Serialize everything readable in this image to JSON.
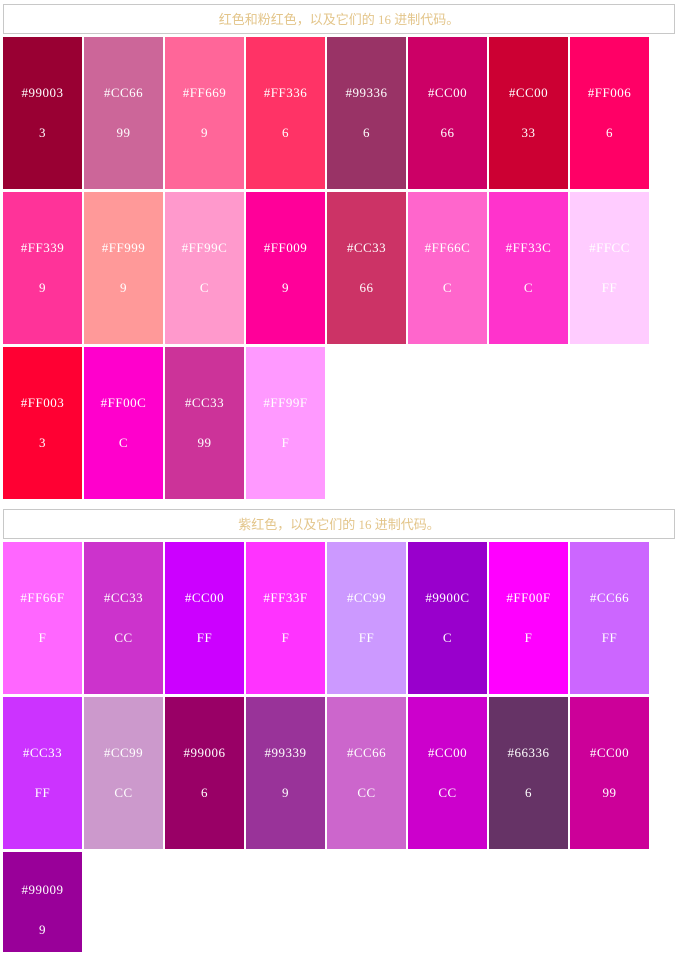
{
  "page": {
    "title": "颜色十六进制代码表",
    "background": "#ffffff",
    "header_text_color": "#e3c58a",
    "header_border_color": "#c8c8c8",
    "swatch_text_color": "#ffffff"
  },
  "sections": [
    {
      "id": "reds-and-pinks",
      "header": "红色和粉红色，以及它们的 16 进制代码。",
      "rows": [
        [
          {
            "hex": "#990033",
            "label": "#990033"
          },
          {
            "hex": "#CC6699",
            "label": "#CC6699"
          },
          {
            "hex": "#FF6699",
            "label": "#FF6699"
          },
          {
            "hex": "#FF3366",
            "label": "#FF3366"
          },
          {
            "hex": "#993366",
            "label": "#993366"
          },
          {
            "hex": "#CC0066",
            "label": "#CC0066"
          },
          {
            "hex": "#CC0033",
            "label": "#CC0033"
          },
          {
            "hex": "#FF0066",
            "label": "#FF0066"
          }
        ],
        [
          {
            "hex": "#FF3399",
            "label": "#FF3399"
          },
          {
            "hex": "#FF9999",
            "label": "#FF9999"
          },
          {
            "hex": "#FF99CC",
            "label": "#FF99CC"
          },
          {
            "hex": "#FF0099",
            "label": "#FF0099"
          },
          {
            "hex": "#CC3366",
            "label": "#CC3366"
          },
          {
            "hex": "#FF66CC",
            "label": "#FF66CC"
          },
          {
            "hex": "#FF33CC",
            "label": "#FF33CC"
          },
          {
            "hex": "#FFCCFF",
            "label": "#FFCCFF"
          }
        ],
        [
          {
            "hex": "#FF0033",
            "label": "#FF0033"
          },
          {
            "hex": "#FF00CC",
            "label": "#FF00CC"
          },
          {
            "hex": "#CC3399",
            "label": "#CC3399"
          },
          {
            "hex": "#FF99FF",
            "label": "#FF99FF"
          }
        ]
      ]
    },
    {
      "id": "magentas-and-purples",
      "header": "紫红色，以及它们的 16 进制代码。",
      "rows": [
        [
          {
            "hex": "#FF66FF",
            "label": "#FF66FF"
          },
          {
            "hex": "#CC33CC",
            "label": "#CC33CC"
          },
          {
            "hex": "#CC00FF",
            "label": "#CC00FF"
          },
          {
            "hex": "#FF33FF",
            "label": "#FF33FF"
          },
          {
            "hex": "#CC99FF",
            "label": "#CC99FF"
          },
          {
            "hex": "#9900CC",
            "label": "#9900CC"
          },
          {
            "hex": "#FF00FF",
            "label": "#FF00FF"
          },
          {
            "hex": "#CC66FF",
            "label": "#CC66FF"
          }
        ],
        [
          {
            "hex": "#CC33FF",
            "label": "#CC33FF"
          },
          {
            "hex": "#CC99CC",
            "label": "#CC99CC"
          },
          {
            "hex": "#990066",
            "label": "#990066"
          },
          {
            "hex": "#993399",
            "label": "#993399"
          },
          {
            "hex": "#CC66CC",
            "label": "#CC66CC"
          },
          {
            "hex": "#CC00CC",
            "label": "#CC00CC"
          },
          {
            "hex": "#663366",
            "label": "#663366"
          },
          {
            "hex": "#CC0099",
            "label": "#CC0099"
          }
        ],
        [
          {
            "hex": "#990099",
            "label": "#990099"
          }
        ]
      ]
    }
  ]
}
